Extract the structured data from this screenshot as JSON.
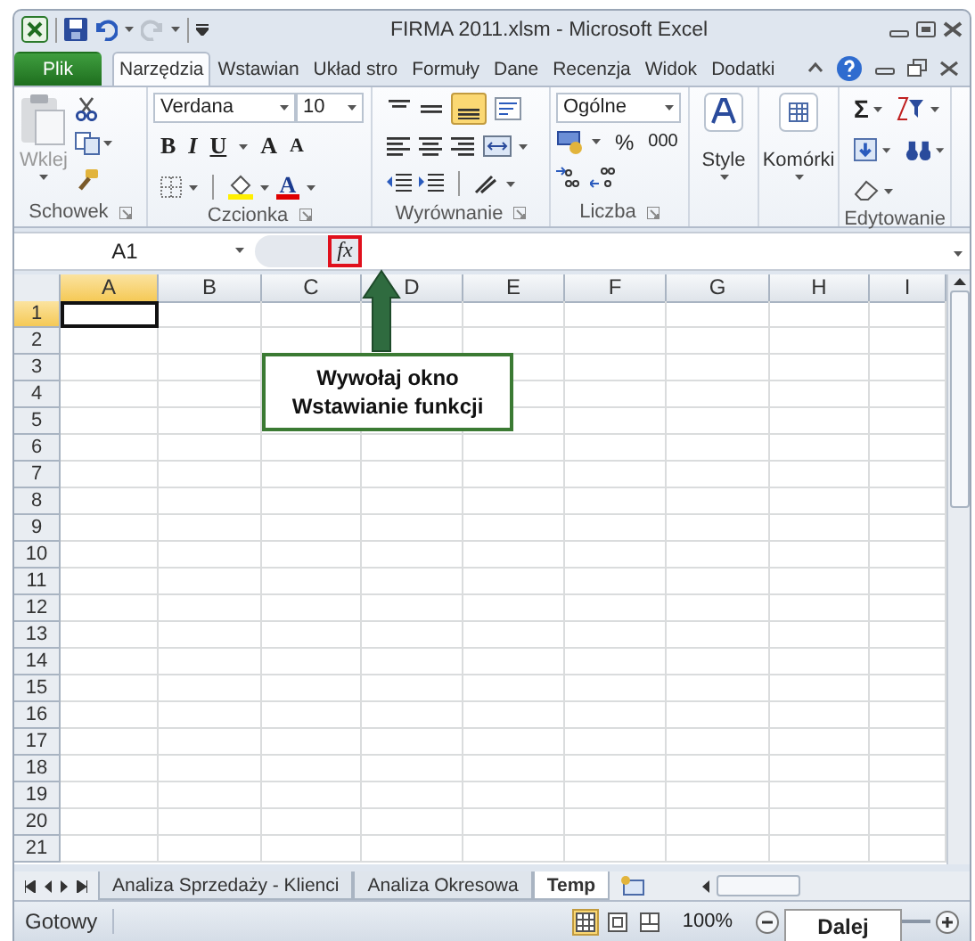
{
  "window": {
    "title": "FIRMA 2011.xlsm  -  Microsoft Excel"
  },
  "quick_access": {
    "redo_disabled": true
  },
  "ribbon_tabs": [
    {
      "label": "Plik",
      "kind": "file",
      "selected": false
    },
    {
      "label": "Narzędzia",
      "kind": "tab",
      "selected": true
    },
    {
      "label": "Wstawian",
      "kind": "tab",
      "selected": false
    },
    {
      "label": "Układ stro",
      "kind": "tab",
      "selected": false
    },
    {
      "label": "Formuły",
      "kind": "tab",
      "selected": false
    },
    {
      "label": "Dane",
      "kind": "tab",
      "selected": false
    },
    {
      "label": "Recenzja",
      "kind": "tab",
      "selected": false
    },
    {
      "label": "Widok",
      "kind": "tab",
      "selected": false
    },
    {
      "label": "Dodatki",
      "kind": "tab",
      "selected": false
    }
  ],
  "clipboard": {
    "label": "Schowek",
    "paste": "Wklej",
    "paste_disabled": true
  },
  "font": {
    "label": "Czcionka",
    "name": "Verdana",
    "size": "10",
    "bold": "B",
    "italic": "I",
    "underline": "U",
    "grow": "A",
    "shrink": "A",
    "font_color_letter": "A"
  },
  "alignment": {
    "label": "Wyrównanie",
    "bottom_align_selected": true
  },
  "number": {
    "label": "Liczba",
    "format": "Ogólne",
    "percent": "%",
    "thousands": "000"
  },
  "styles": {
    "label": "Style"
  },
  "cells": {
    "label": "Komórki"
  },
  "editing": {
    "label": "Edytowanie",
    "sum": "Σ"
  },
  "formula_bar": {
    "name_box": "A1",
    "fx": "fx",
    "fx_highlighted": true
  },
  "grid": {
    "columns": [
      {
        "label": "A",
        "selected": true
      },
      {
        "label": "B",
        "selected": false
      },
      {
        "label": "C",
        "selected": false
      },
      {
        "label": "D",
        "selected": false
      },
      {
        "label": "E",
        "selected": false
      },
      {
        "label": "F",
        "selected": false
      },
      {
        "label": "G",
        "selected": false
      },
      {
        "label": "H",
        "selected": false
      },
      {
        "label": "I",
        "selected": false
      }
    ],
    "rows": [
      {
        "label": "1",
        "selected": true
      },
      {
        "label": "2",
        "selected": false
      },
      {
        "label": "3",
        "selected": false
      },
      {
        "label": "4",
        "selected": false
      },
      {
        "label": "5",
        "selected": false
      },
      {
        "label": "6",
        "selected": false
      },
      {
        "label": "7",
        "selected": false
      },
      {
        "label": "8",
        "selected": false
      },
      {
        "label": "9",
        "selected": false
      },
      {
        "label": "10",
        "selected": false
      },
      {
        "label": "11",
        "selected": false
      },
      {
        "label": "12",
        "selected": false
      },
      {
        "label": "13",
        "selected": false
      },
      {
        "label": "14",
        "selected": false
      },
      {
        "label": "15",
        "selected": false
      },
      {
        "label": "16",
        "selected": false
      },
      {
        "label": "17",
        "selected": false
      },
      {
        "label": "18",
        "selected": false
      },
      {
        "label": "19",
        "selected": false
      },
      {
        "label": "20",
        "selected": false
      },
      {
        "label": "21",
        "selected": false
      }
    ]
  },
  "callout": {
    "text": "Wywołaj okno\nWstawianie funkcji"
  },
  "sheet_tabs": [
    {
      "label": "Analiza Sprzedaży - Klienci",
      "selected": false
    },
    {
      "label": "Analiza Okresowa",
      "selected": false
    },
    {
      "label": "Temp",
      "selected": true
    }
  ],
  "status_bar": {
    "status": "Gotowy",
    "zoom": "100%",
    "views": [
      {
        "kind": "normal",
        "selected": true
      },
      {
        "kind": "layout",
        "selected": false
      },
      {
        "kind": "breaks",
        "selected": false
      }
    ]
  },
  "next_button": {
    "label": "Dalej"
  }
}
